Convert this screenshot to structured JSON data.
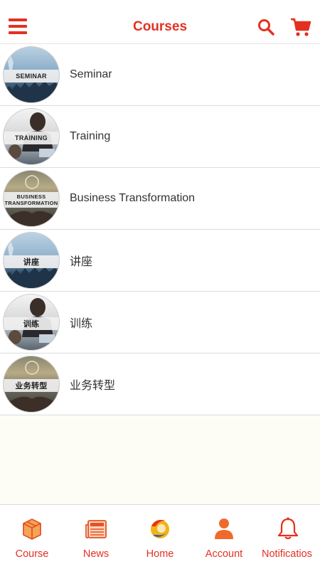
{
  "header": {
    "title": "Courses",
    "accent_color": "#e53021",
    "left_icon": "menu-icon",
    "right_icons": [
      "search-icon",
      "cart-icon"
    ]
  },
  "courses": [
    {
      "label": "Seminar",
      "badge": "SEMINAR"
    },
    {
      "label": "Training",
      "badge": "TRAINING"
    },
    {
      "label": "Business Transformation",
      "badge": "BUSINESS TRANSFORMATION"
    },
    {
      "label": "讲座",
      "badge": "讲座"
    },
    {
      "label": "训练",
      "badge": "训练"
    },
    {
      "label": "业务转型",
      "badge": "业务转型"
    }
  ],
  "tabbar": {
    "items": [
      {
        "label": "Course",
        "icon": "box-icon"
      },
      {
        "label": "News",
        "icon": "newspaper-icon"
      },
      {
        "label": "Home",
        "icon": "logo-icon"
      },
      {
        "label": "Account",
        "icon": "person-icon"
      },
      {
        "label": "Notificatios",
        "icon": "bell-icon"
      }
    ]
  }
}
